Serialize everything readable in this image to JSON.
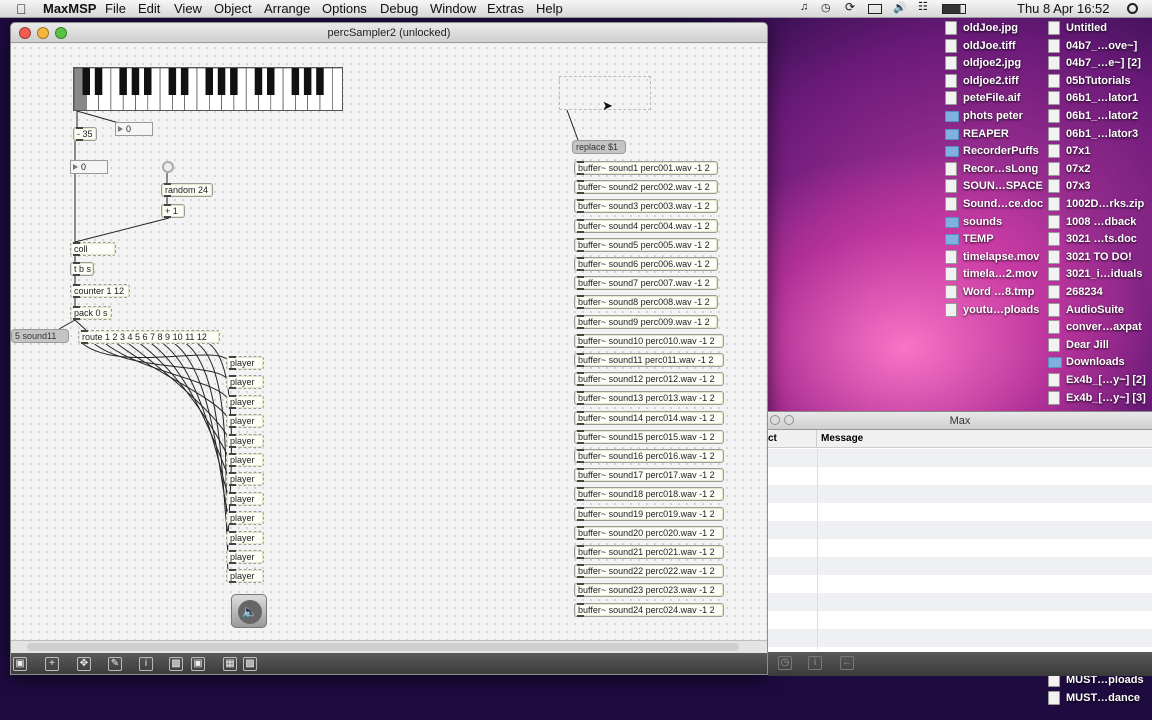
{
  "menubar": {
    "app": "MaxMSP",
    "items": [
      "File",
      "Edit",
      "View",
      "Object",
      "Arrange",
      "Options",
      "Debug",
      "Window",
      "Extras",
      "Help"
    ],
    "clock": "Thu 8 Apr  16:52",
    "status_icons": [
      "music-icon",
      "clock-icon",
      "sync-icon",
      "display-icon",
      "volume-icon",
      "wifi-icon",
      "battery-icon",
      "spotlight-icon"
    ]
  },
  "patcher": {
    "title": "percSampler2 (unlocked)",
    "objects": {
      "minus": "- 35",
      "numA": "0",
      "numB": "0",
      "random": "random 24",
      "plus": "+ 1",
      "coll": "coll",
      "tbs": "t b s",
      "counter": "counter 1 12",
      "pack": "pack 0 s",
      "sym": "5 sound11",
      "route": "route 1 2 3 4 5 6 7 8 9 10 11 12",
      "replace": "replace $1",
      "player": "player"
    },
    "buffers": [
      "buffer~ sound1 perc001.wav -1 2",
      "buffer~ sound2 perc002.wav -1 2",
      "buffer~ sound3 perc003.wav -1 2",
      "buffer~ sound4 perc004.wav -1 2",
      "buffer~ sound5 perc005.wav -1 2",
      "buffer~ sound6 perc006.wav -1 2",
      "buffer~ sound7 perc007.wav -1 2",
      "buffer~ sound8 perc008.wav -1 2",
      "buffer~ sound9 perc009.wav -1 2",
      "buffer~ sound10 perc010.wav -1 2",
      "buffer~ sound11 perc011.wav -1 2",
      "buffer~ sound12 perc012.wav -1 2",
      "buffer~ sound13 perc013.wav -1 2",
      "buffer~ sound14 perc014.wav -1 2",
      "buffer~ sound15 perc015.wav -1 2",
      "buffer~ sound16 perc016.wav -1 2",
      "buffer~ sound17 perc017.wav -1 2",
      "buffer~ sound18 perc018.wav -1 2",
      "buffer~ sound19 perc019.wav -1 2",
      "buffer~ sound20 perc020.wav -1 2",
      "buffer~ sound21 perc021.wav -1 2",
      "buffer~ sound22 perc022.wav -1 2",
      "buffer~ sound23 perc023.wav -1 2",
      "buffer~ sound24 perc024.wav -1 2"
    ],
    "toolbar_icons": [
      "lock-icon",
      "add-icon",
      "move-icon",
      "edit-icon",
      "info-icon",
      "disabled-icon",
      "presentation-icon",
      "grid-icon",
      "snap-icon"
    ]
  },
  "maxwindow": {
    "title": "Max",
    "col1": "ct",
    "col2": "Message"
  },
  "desktop": {
    "col1": [
      "oldJoe.jpg",
      "oldJoe.tiff",
      "oldjoe2.jpg",
      "oldjoe2.tiff",
      "peteFile.aif",
      "phots peter",
      "REAPER",
      "RecorderPuffs",
      "Recor…sLong",
      "SOUN…SPACE",
      "Sound…ce.doc",
      "sounds",
      "TEMP",
      "timelapse.mov",
      "timela…2.mov",
      "Word …8.tmp",
      "youtu…ploads"
    ],
    "col2": [
      "Untitled",
      "04b7_…ove~]",
      "04b7_…e~] [2]",
      "05bTutorials",
      "06b1_…lator1",
      "06b1_…lator2",
      "06b1_…lator3",
      "07x1",
      "07x2",
      "07x3",
      "1002D…rks.zip",
      "1008 …dback",
      "3021 …ts.doc",
      "3021 TO DO!",
      "3021_i…iduals",
      "268234",
      "AudioSuite",
      "conver…axpat",
      "Dear Jill",
      "Downloads",
      "Ex4b_[…y~] [2]",
      "Ex4b_[…y~] [3]"
    ],
    "col2_bottom": [
      "MUST…ploads",
      "MUST…dance"
    ],
    "col1_kinds": [
      "doc",
      "doc",
      "doc",
      "doc",
      "doc",
      "fold",
      "fold",
      "fold",
      "doc",
      "doc",
      "doc",
      "fold",
      "fold",
      "doc",
      "doc",
      "doc",
      "doc"
    ],
    "col2_kinds": [
      "doc",
      "doc",
      "doc",
      "doc",
      "doc",
      "doc",
      "doc",
      "doc",
      "doc",
      "doc",
      "doc",
      "doc",
      "doc",
      "doc",
      "doc",
      "doc",
      "doc",
      "doc",
      "doc",
      "fold",
      "doc",
      "doc"
    ]
  }
}
